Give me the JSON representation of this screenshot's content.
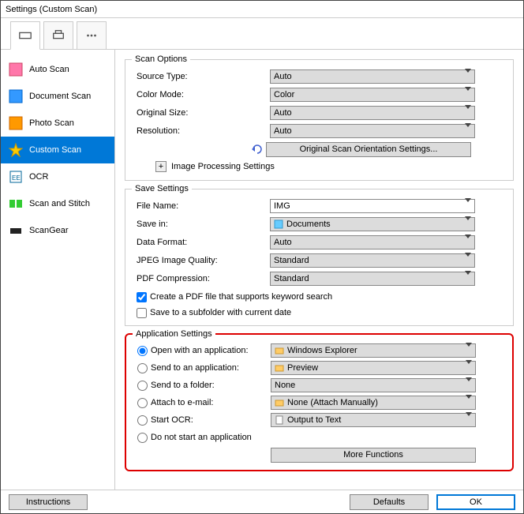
{
  "window": {
    "title": "Settings (Custom Scan)"
  },
  "toolbar": {
    "tab_scanner": "scanner",
    "tab_printer": "printer",
    "tab_more": "more"
  },
  "sidebar": {
    "items": [
      {
        "label": "Auto Scan"
      },
      {
        "label": "Document Scan"
      },
      {
        "label": "Photo Scan"
      },
      {
        "label": "Custom Scan"
      },
      {
        "label": "OCR"
      },
      {
        "label": "Scan and Stitch"
      },
      {
        "label": "ScanGear"
      }
    ]
  },
  "scan_options": {
    "legend": "Scan Options",
    "source_type_label": "Source Type:",
    "source_type_value": "Auto",
    "color_mode_label": "Color Mode:",
    "color_mode_value": "Color",
    "original_size_label": "Original Size:",
    "original_size_value": "Auto",
    "resolution_label": "Resolution:",
    "resolution_value": "Auto",
    "orientation_btn": "Original Scan Orientation Settings...",
    "expander_label": "Image Processing Settings"
  },
  "save_settings": {
    "legend": "Save Settings",
    "file_name_label": "File Name:",
    "file_name_value": "IMG",
    "save_in_label": "Save in:",
    "save_in_value": "Documents",
    "data_format_label": "Data Format:",
    "data_format_value": "Auto",
    "jpeg_label": "JPEG Image Quality:",
    "jpeg_value": "Standard",
    "pdf_label": "PDF Compression:",
    "pdf_value": "Standard",
    "chk_pdf_search": "Create a PDF file that supports keyword search",
    "chk_subfolder": "Save to a subfolder with current date"
  },
  "app_settings": {
    "legend": "Application Settings",
    "open_with_label": "Open with an application:",
    "open_with_value": "Windows Explorer",
    "send_app_label": "Send to an application:",
    "send_app_value": "Preview",
    "send_folder_label": "Send to a folder:",
    "send_folder_value": "None",
    "attach_label": "Attach to e-mail:",
    "attach_value": "None (Attach Manually)",
    "ocr_label": "Start OCR:",
    "ocr_value": "Output to Text",
    "do_not_start": "Do not start an application",
    "more_functions": "More Functions"
  },
  "footer": {
    "instructions": "Instructions",
    "defaults": "Defaults",
    "ok": "OK"
  }
}
